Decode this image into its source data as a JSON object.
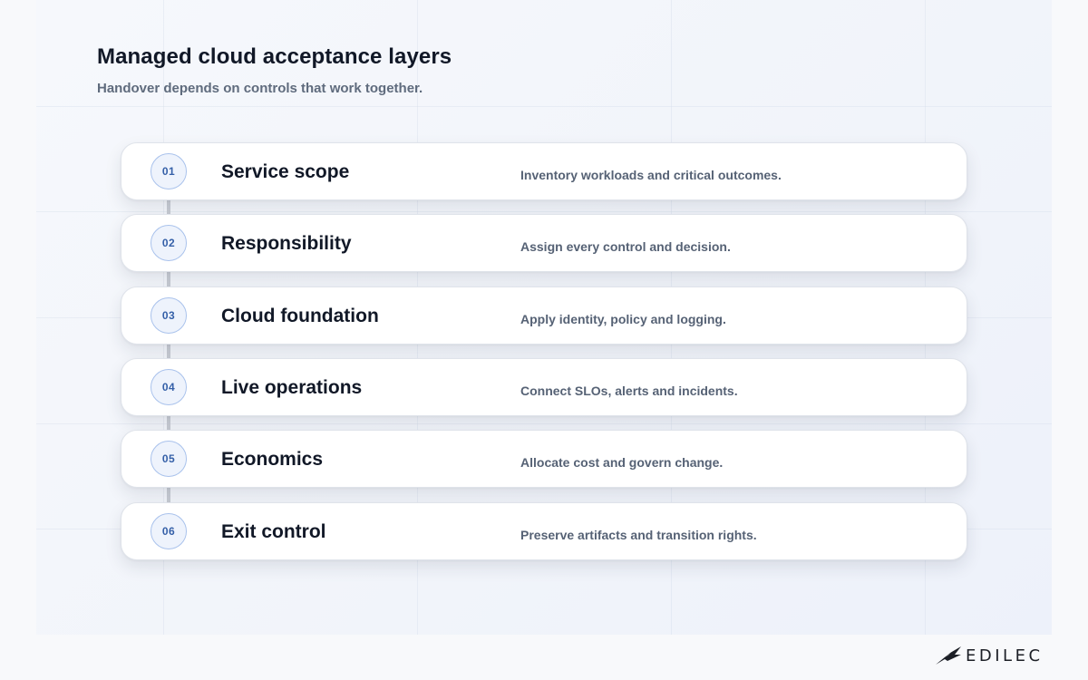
{
  "header": {
    "title": "Managed cloud acceptance layers",
    "subtitle": "Handover depends on controls that work together."
  },
  "colors": {
    "accent": "#3560a8",
    "badge_border": "#a9c2ec",
    "badge_fill": "#eef3fc",
    "title_text": "#111827",
    "muted_text": "#566275",
    "connector": "#c8ccd4"
  },
  "layers": [
    {
      "number": "01",
      "label": "Service scope",
      "description": "Inventory workloads and critical outcomes."
    },
    {
      "number": "02",
      "label": "Responsibility",
      "description": "Assign every control and decision."
    },
    {
      "number": "03",
      "label": "Cloud foundation",
      "description": "Apply identity, policy and logging."
    },
    {
      "number": "04",
      "label": "Live operations",
      "description": "Connect SLOs, alerts and incidents."
    },
    {
      "number": "05",
      "label": "Economics",
      "description": "Allocate cost and govern change."
    },
    {
      "number": "06",
      "label": "Exit control",
      "description": "Preserve artifacts and transition rights."
    }
  ],
  "brand": {
    "name": "EDILEC",
    "icon": "bird-wing-logo-icon"
  }
}
